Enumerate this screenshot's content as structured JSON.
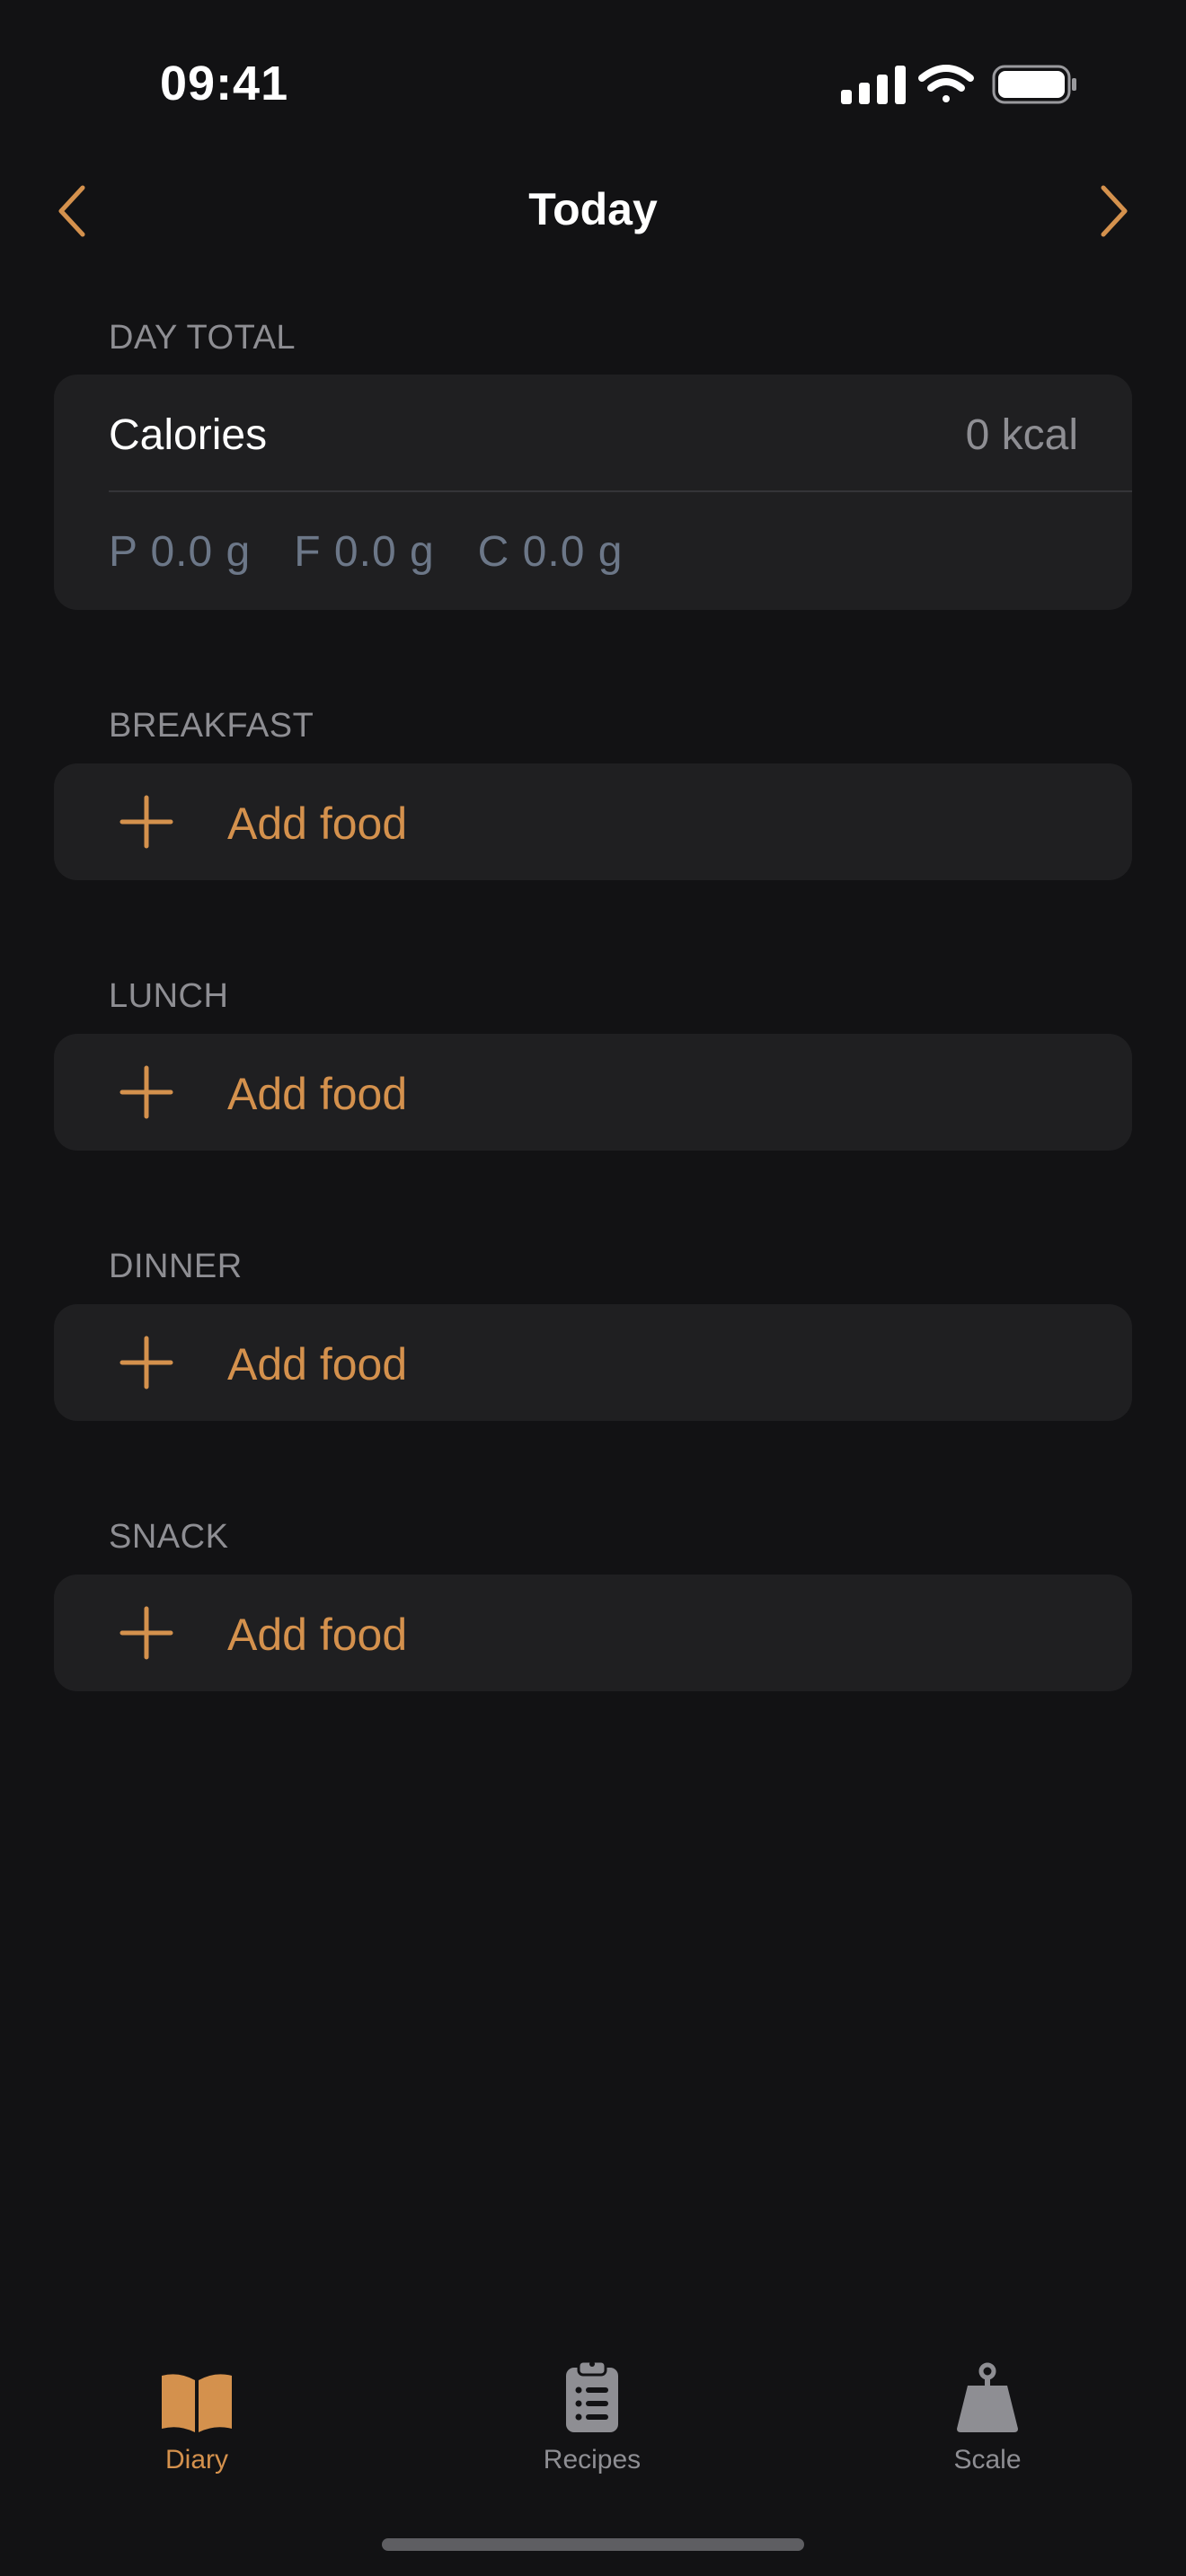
{
  "status_bar": {
    "time": "09:41",
    "icons": [
      "cellular-signal-icon",
      "wifi-icon",
      "battery-icon"
    ]
  },
  "nav": {
    "title": "Today",
    "prev_icon": "chevron-left-icon",
    "next_icon": "chevron-right-icon"
  },
  "day_total": {
    "header": "DAY TOTAL",
    "calories_label": "Calories",
    "calories_value": "0 kcal",
    "protein": "P 0.0 g",
    "fat": "F 0.0 g",
    "carbs": "C 0.0 g"
  },
  "meals": [
    {
      "header": "BREAKFAST",
      "add_label": "Add food"
    },
    {
      "header": "LUNCH",
      "add_label": "Add food"
    },
    {
      "header": "DINNER",
      "add_label": "Add food"
    },
    {
      "header": "SNACK",
      "add_label": "Add food"
    }
  ],
  "tabs": [
    {
      "label": "Diary",
      "icon": "book-icon",
      "active": true
    },
    {
      "label": "Recipes",
      "icon": "clipboard-list-icon",
      "active": false
    },
    {
      "label": "Scale",
      "icon": "weight-icon",
      "active": false
    }
  ],
  "colors": {
    "background": "#121214",
    "card": "#1f1f21",
    "accent": "#d4914d",
    "secondary_text": "#8e8e93",
    "macro_text": "#6c7788"
  }
}
